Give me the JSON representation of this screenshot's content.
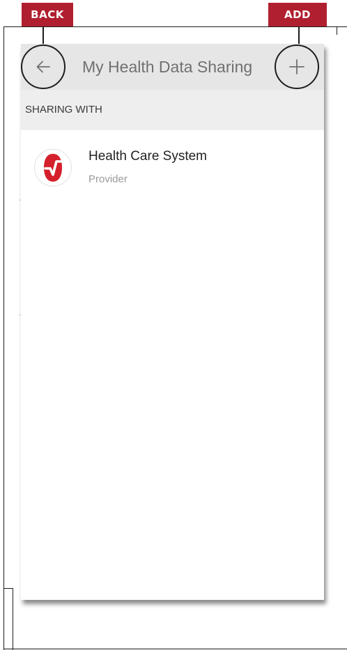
{
  "callouts": {
    "back_label": "BACK",
    "add_label": "ADD",
    "color": "#b01f2f"
  },
  "app_bar": {
    "title": "My Health Data Sharing",
    "back_icon": "arrow-left-icon",
    "add_icon": "plus-icon"
  },
  "section": {
    "label": "SHARING WITH"
  },
  "sharing_list": [
    {
      "name": "Health Care System",
      "role": "Provider",
      "logo": "health-system-logo-icon",
      "logo_color": "#d4202c"
    }
  ]
}
